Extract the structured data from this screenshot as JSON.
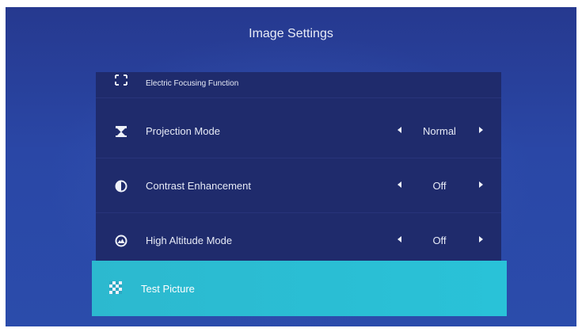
{
  "title": "Image Settings",
  "items": [
    {
      "label": "Electric Focusing Function",
      "icon": "focus-bracket-icon"
    },
    {
      "label": "Projection Mode",
      "value": "Normal",
      "icon": "projection-mode-icon"
    },
    {
      "label": "Contrast Enhancement",
      "value": "Off",
      "icon": "contrast-icon"
    },
    {
      "label": "High Altitude Mode",
      "value": "Off",
      "icon": "mountain-icon"
    },
    {
      "label": "Test Picture",
      "icon": "checkerboard-icon",
      "selected": true
    }
  ],
  "colors": {
    "background": "#2a47a6",
    "panel": "#1f2b6c",
    "highlight": "#29c2d8",
    "text": "#e6eaf6"
  }
}
